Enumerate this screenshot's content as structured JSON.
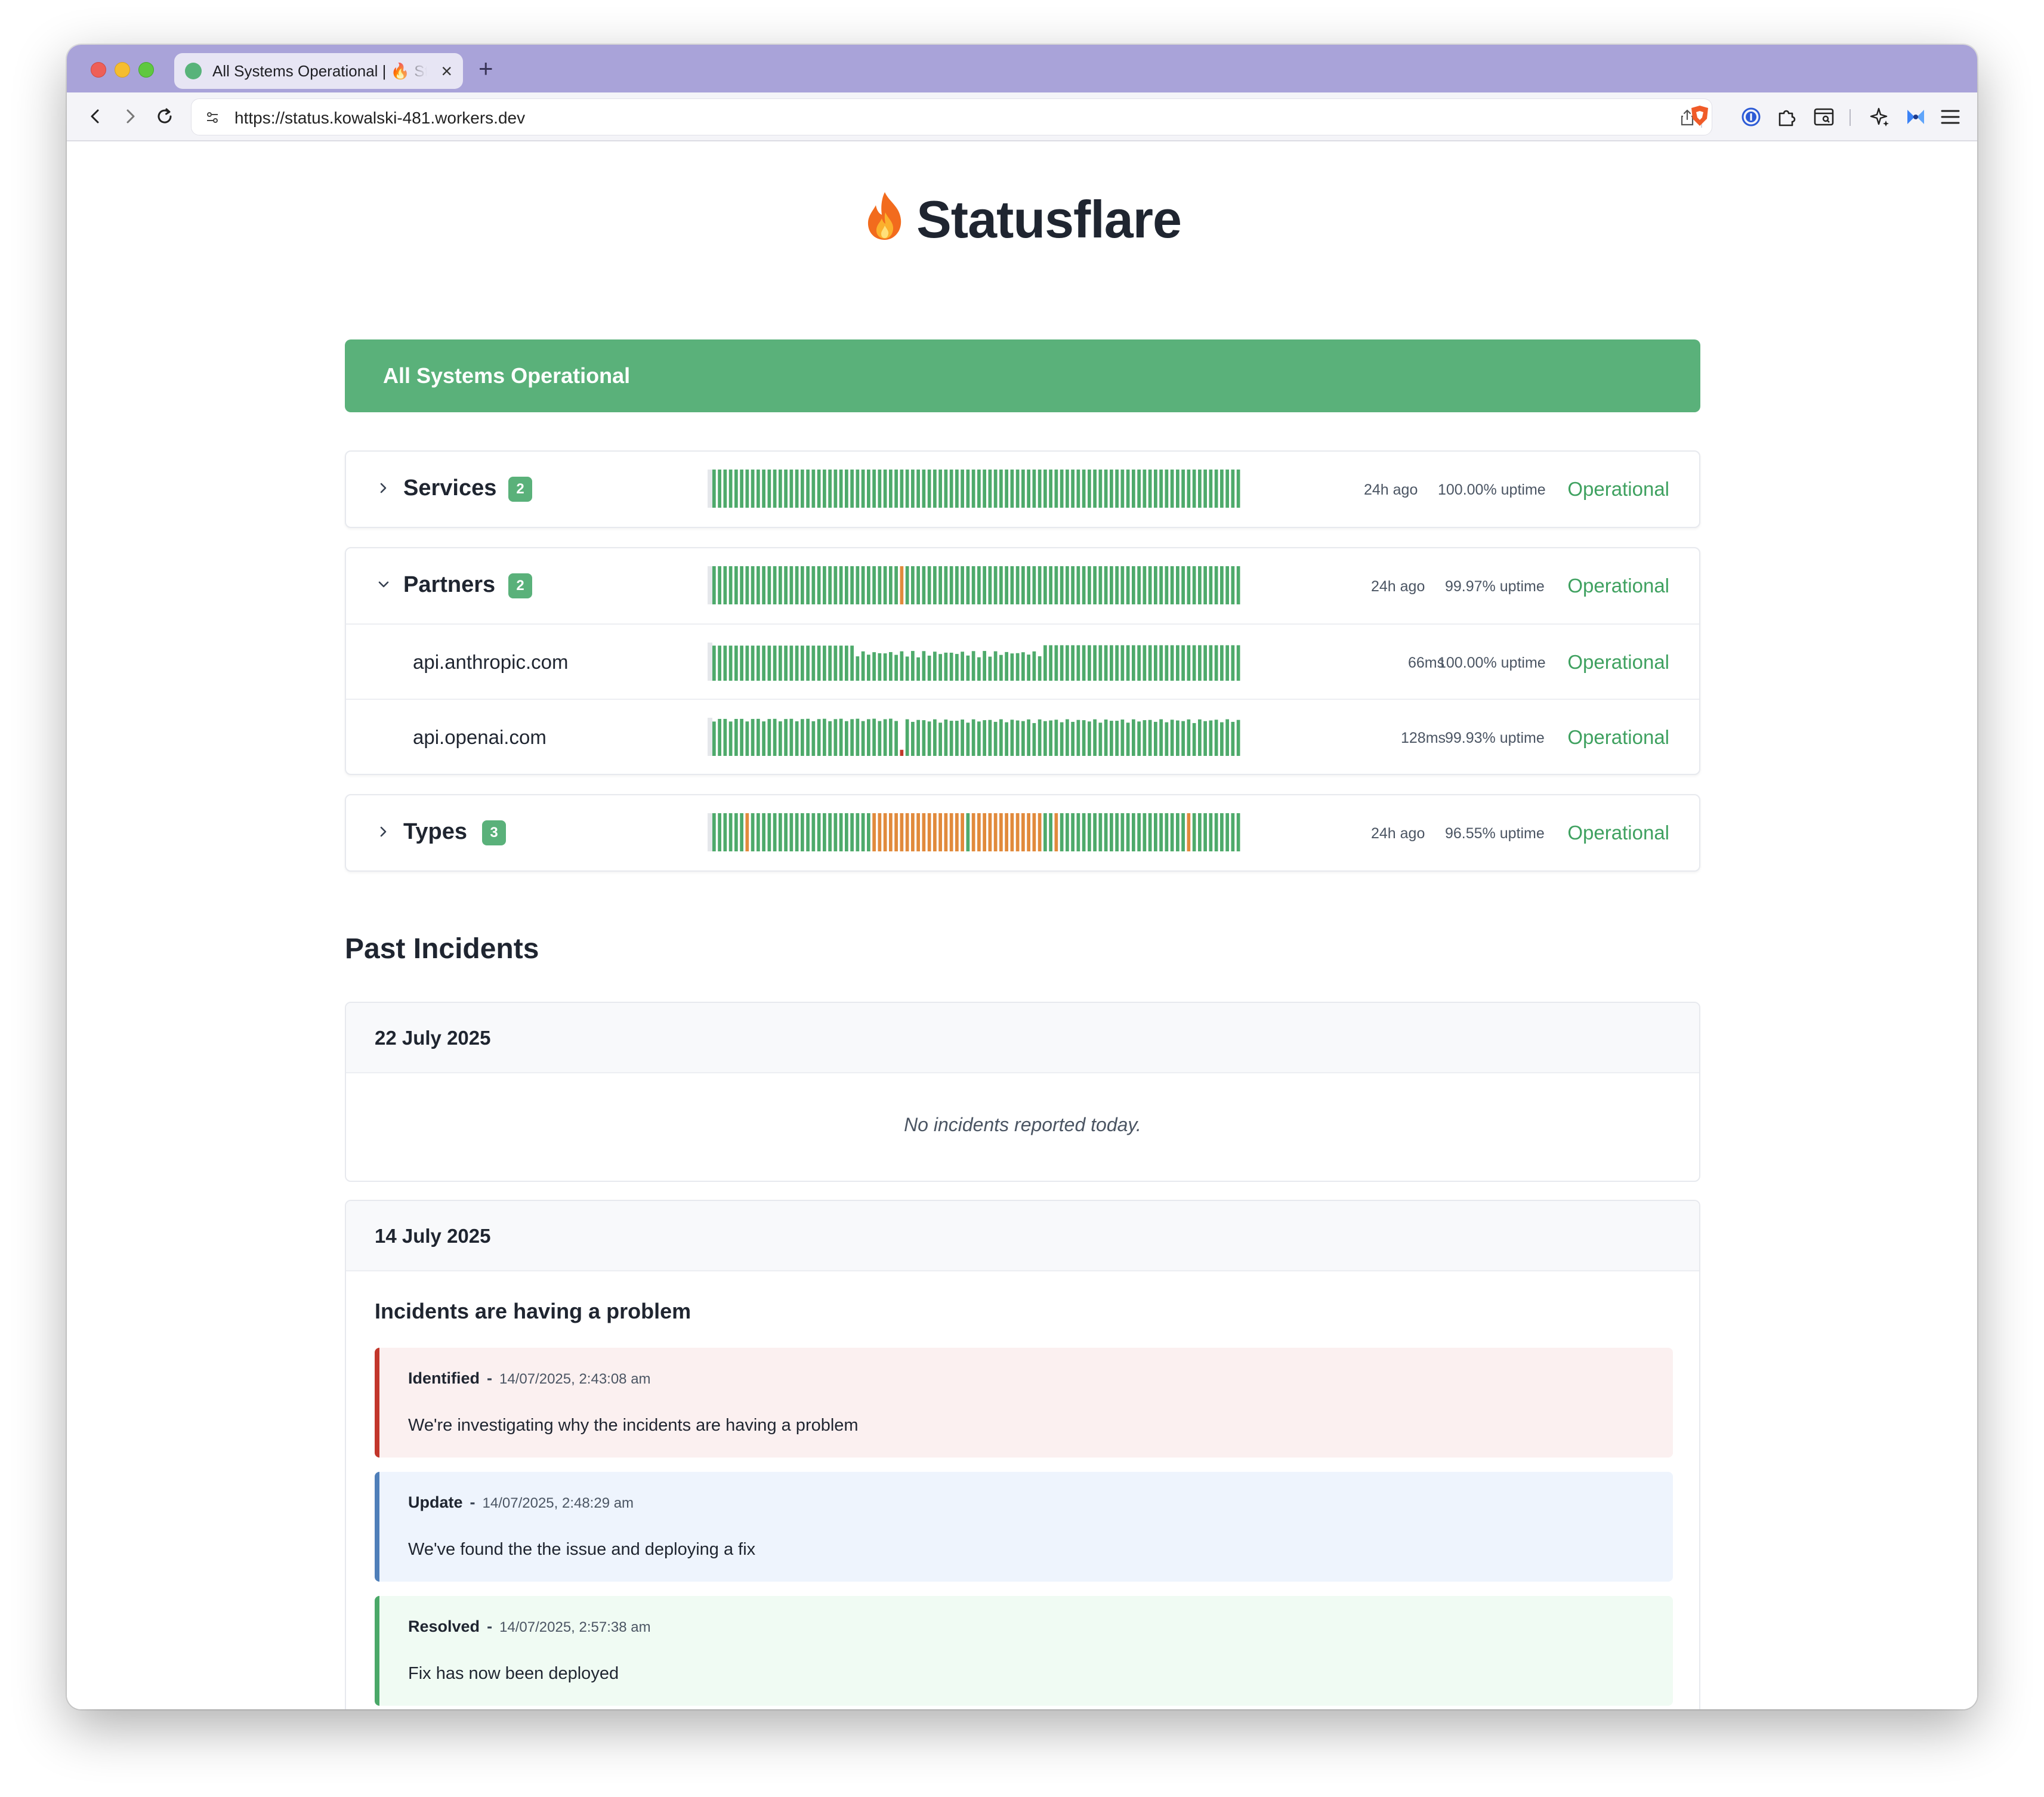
{
  "browser": {
    "tab_title": "All Systems Operational | 🔥 Statusflare",
    "tab_close": "×",
    "new_tab": "+",
    "url": "https://status.kowalski-481.workers.dev"
  },
  "header": {
    "flame_icon": "flame-icon",
    "title": "Statusflare"
  },
  "banner": {
    "text": "All Systems Operational",
    "color": "#5ab17a"
  },
  "colors": {
    "up": "#4eaa6b",
    "degraded": "#e18a3c",
    "down": "#c0392b",
    "empty": "#e5e7eb",
    "operational": "#3fa160"
  },
  "groups": [
    {
      "name": "Services",
      "count": "2",
      "expanded": false,
      "time": "24h ago",
      "uptime": "100.00% uptime",
      "status": "Operational",
      "bars": {
        "n": 96,
        "degraded": [],
        "down": [],
        "heights": "full"
      }
    },
    {
      "name": "Partners",
      "count": "2",
      "expanded": true,
      "time": "24h ago",
      "uptime": "99.97% uptime",
      "status": "Operational",
      "bars": {
        "n": 96,
        "degraded": [
          34
        ],
        "down": [],
        "heights": "full"
      },
      "monitors": [
        {
          "name": "api.anthropic.com",
          "time": "66ms",
          "uptime": "100.00% uptime",
          "status": "Operational",
          "bars": {
            "n": 96,
            "degraded": [],
            "down": [],
            "heights": "anthropic"
          }
        },
        {
          "name": "api.openai.com",
          "time": "128ms",
          "uptime": "99.93% uptime",
          "status": "Operational",
          "bars": {
            "n": 96,
            "degraded": [],
            "down": [
              34
            ],
            "heights": "openai"
          }
        }
      ]
    },
    {
      "name": "Types",
      "count": "3",
      "expanded": false,
      "time": "24h ago",
      "uptime": "96.55% uptime",
      "status": "Operational",
      "bars": {
        "n": 96,
        "degraded": [
          6,
          29,
          30,
          31,
          32,
          33,
          34,
          35,
          36,
          37,
          38,
          39,
          40,
          41,
          42,
          43,
          44,
          45,
          47,
          48,
          49,
          50,
          51,
          52,
          53,
          54,
          55,
          56,
          57,
          58,
          59,
          62,
          86
        ],
        "down": [],
        "heights": "full"
      }
    }
  ],
  "incidents_section": {
    "title": "Past Incidents",
    "days": [
      {
        "date": "22 July 2025",
        "empty_text": "No incidents reported today."
      },
      {
        "date": "14 July 2025",
        "incident_title": "Incidents are having a problem",
        "updates": [
          {
            "label": "Identified",
            "separator": "-",
            "time": "14/07/2025, 2:43:08 am",
            "message": "We're investigating why the incidents are having a problem",
            "tone": "red"
          },
          {
            "label": "Update",
            "separator": "-",
            "time": "14/07/2025, 2:48:29 am",
            "message": "We've found the the issue and deploying a fix",
            "tone": "blue"
          },
          {
            "label": "Resolved",
            "separator": "-",
            "time": "14/07/2025, 2:57:38 am",
            "message": "Fix has now been deployed",
            "tone": "green"
          }
        ]
      }
    ]
  }
}
